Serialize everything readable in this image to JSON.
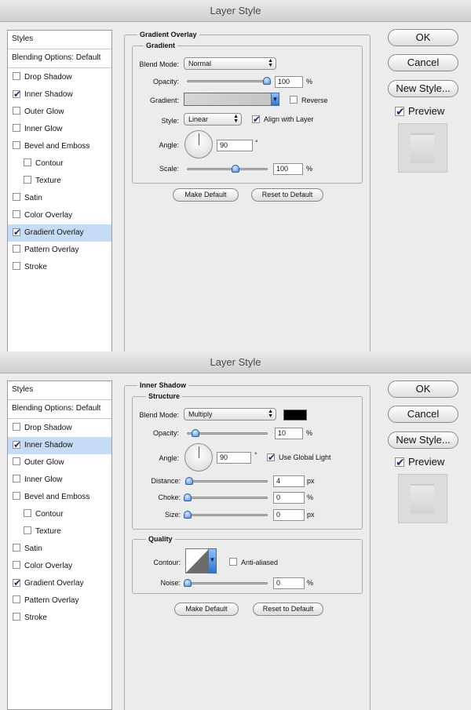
{
  "gradient_dialog": {
    "title": "Layer Style",
    "styles_header": "Styles",
    "blending_options": "Blending Options: Default",
    "style_items": [
      {
        "label": "Drop Shadow",
        "checked": false,
        "sub": false,
        "selected": false
      },
      {
        "label": "Inner Shadow",
        "checked": true,
        "sub": false,
        "selected": false
      },
      {
        "label": "Outer Glow",
        "checked": false,
        "sub": false,
        "selected": false
      },
      {
        "label": "Inner Glow",
        "checked": false,
        "sub": false,
        "selected": false
      },
      {
        "label": "Bevel and Emboss",
        "checked": false,
        "sub": false,
        "selected": false
      },
      {
        "label": "Contour",
        "checked": false,
        "sub": true,
        "selected": false
      },
      {
        "label": "Texture",
        "checked": false,
        "sub": true,
        "selected": false
      },
      {
        "label": "Satin",
        "checked": false,
        "sub": false,
        "selected": false
      },
      {
        "label": "Color Overlay",
        "checked": false,
        "sub": false,
        "selected": false
      },
      {
        "label": "Gradient Overlay",
        "checked": true,
        "sub": false,
        "selected": true
      },
      {
        "label": "Pattern Overlay",
        "checked": false,
        "sub": false,
        "selected": false
      },
      {
        "label": "Stroke",
        "checked": false,
        "sub": false,
        "selected": false
      }
    ],
    "group_title": "Gradient Overlay",
    "subgroup_title": "Gradient",
    "blend_mode_label": "Blend Mode:",
    "blend_mode_value": "Normal",
    "opacity_label": "Opacity:",
    "opacity_value": "100",
    "opacity_fraction": 1.0,
    "percent_unit": "%",
    "gradient_label": "Gradient:",
    "reverse_label": "Reverse",
    "reverse_checked": false,
    "style_label": "Style:",
    "style_value": "Linear",
    "align_label": "Align with Layer",
    "align_checked": true,
    "angle_label": "Angle:",
    "angle_value": "90",
    "degree_unit": "°",
    "scale_label": "Scale:",
    "scale_value": "100",
    "scale_fraction": 0.6,
    "make_default": "Make Default",
    "reset_default": "Reset to Default",
    "ok_label": "OK",
    "cancel_label": "Cancel",
    "new_style_label": "New Style...",
    "preview_label": "Preview",
    "preview_checked": true
  },
  "shadow_dialog": {
    "title": "Layer Style",
    "styles_header": "Styles",
    "blending_options": "Blending Options: Default",
    "style_items": [
      {
        "label": "Drop Shadow",
        "checked": false,
        "sub": false,
        "selected": false
      },
      {
        "label": "Inner Shadow",
        "checked": true,
        "sub": false,
        "selected": true
      },
      {
        "label": "Outer Glow",
        "checked": false,
        "sub": false,
        "selected": false
      },
      {
        "label": "Inner Glow",
        "checked": false,
        "sub": false,
        "selected": false
      },
      {
        "label": "Bevel and Emboss",
        "checked": false,
        "sub": false,
        "selected": false
      },
      {
        "label": "Contour",
        "checked": false,
        "sub": true,
        "selected": false
      },
      {
        "label": "Texture",
        "checked": false,
        "sub": true,
        "selected": false
      },
      {
        "label": "Satin",
        "checked": false,
        "sub": false,
        "selected": false
      },
      {
        "label": "Color Overlay",
        "checked": false,
        "sub": false,
        "selected": false
      },
      {
        "label": "Gradient Overlay",
        "checked": true,
        "sub": false,
        "selected": false
      },
      {
        "label": "Pattern Overlay",
        "checked": false,
        "sub": false,
        "selected": false
      },
      {
        "label": "Stroke",
        "checked": false,
        "sub": false,
        "selected": false
      }
    ],
    "group_title": "Inner Shadow",
    "structure_title": "Structure",
    "blend_mode_label": "Blend Mode:",
    "blend_mode_value": "Multiply",
    "shadow_color": "#000000",
    "opacity_label": "Opacity:",
    "opacity_value": "10",
    "opacity_fraction": 0.1,
    "percent_unit": "%",
    "px_unit": "px",
    "angle_label": "Angle:",
    "angle_value": "90",
    "degree_unit": "°",
    "global_light_label": "Use Global Light",
    "global_light_checked": true,
    "distance_label": "Distance:",
    "distance_value": "4",
    "distance_fraction": 0.02,
    "choke_label": "Choke:",
    "choke_value": "0",
    "size_label": "Size:",
    "size_value": "0",
    "quality_title": "Quality",
    "contour_label": "Contour:",
    "anti_aliased_label": "Anti-aliased",
    "anti_aliased_checked": false,
    "noise_label": "Noise:",
    "noise_value": "0",
    "make_default": "Make Default",
    "reset_default": "Reset to Default",
    "ok_label": "OK",
    "cancel_label": "Cancel",
    "new_style_label": "New Style...",
    "preview_label": "Preview",
    "preview_checked": true
  }
}
